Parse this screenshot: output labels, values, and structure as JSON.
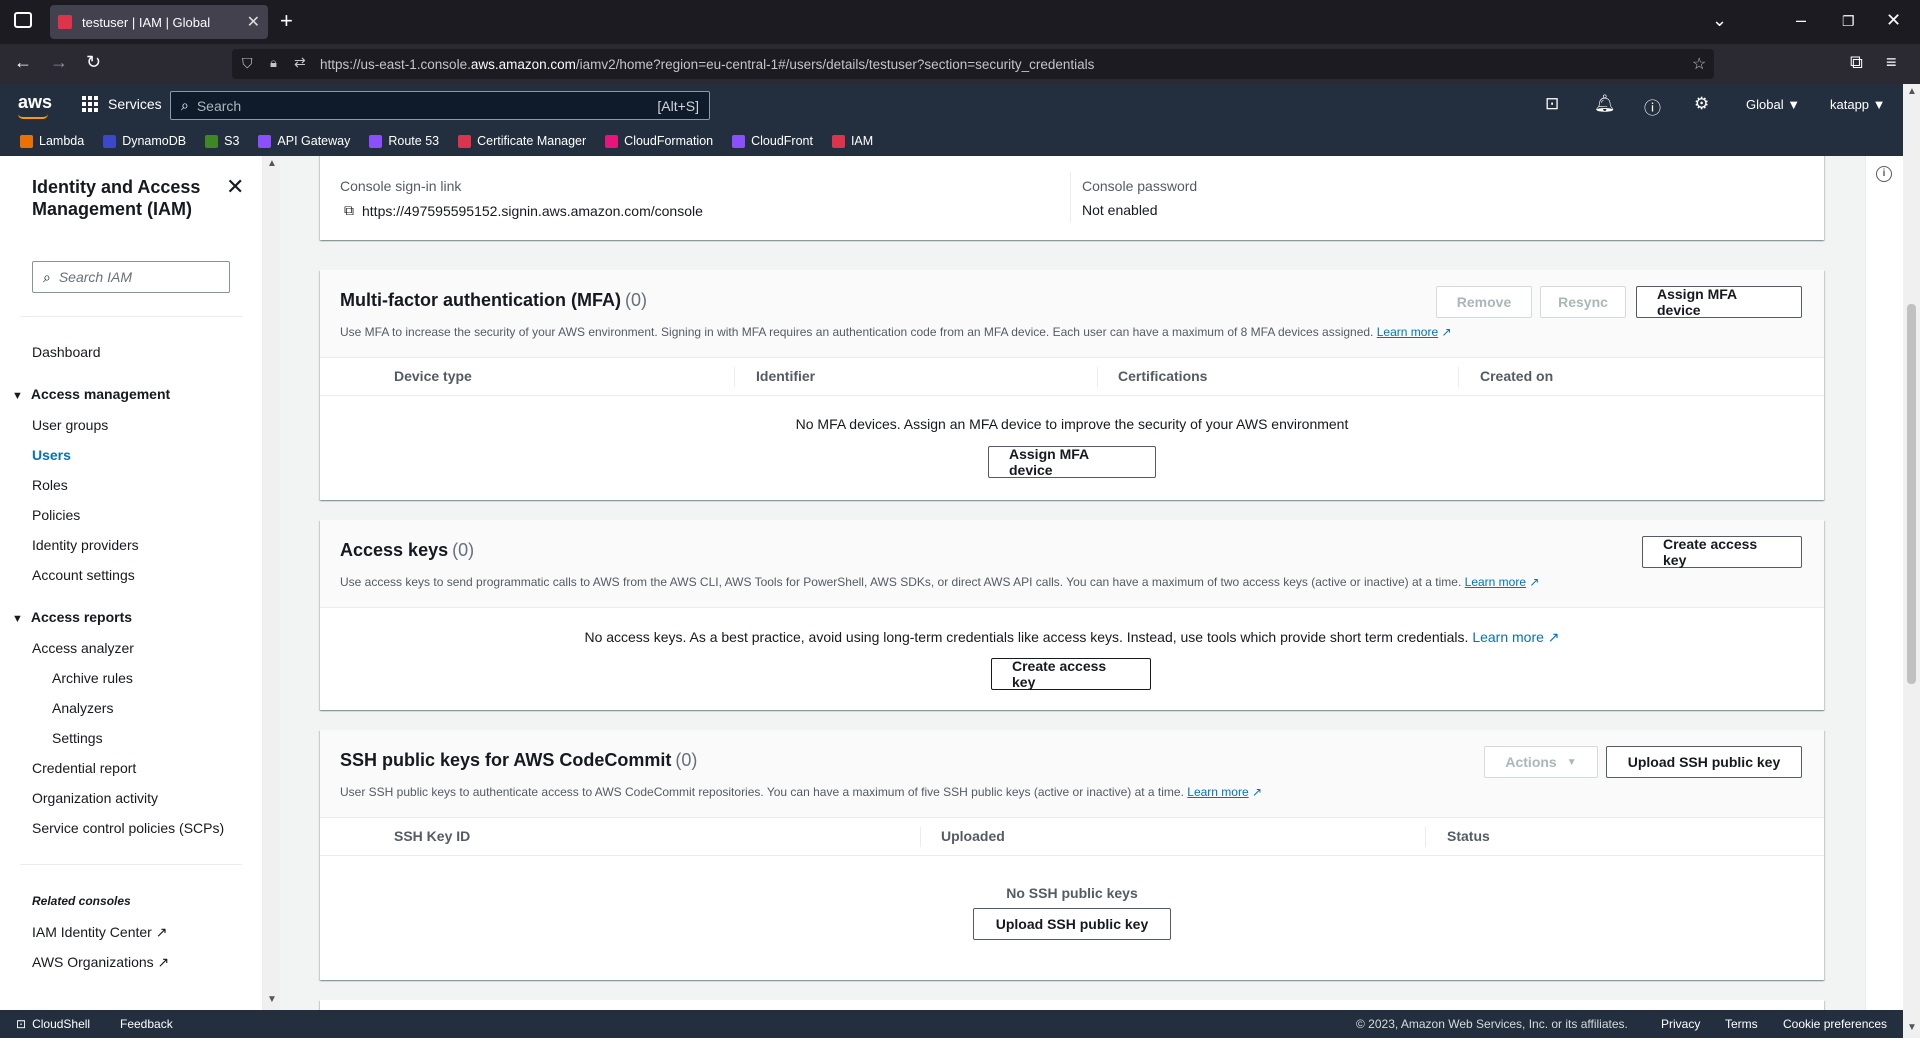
{
  "browser": {
    "tab_title": "testuser | IAM | Global",
    "url_prefix": "https://us-east-1.console.",
    "url_domain": "aws.amazon.com",
    "url_suffix": "/iamv2/home?region=eu-central-1#/users/details/testuser?section=security_credentials"
  },
  "aws_header": {
    "logo": "aws",
    "services": "Services",
    "search_placeholder": "Search",
    "search_shortcut": "[Alt+S]",
    "region": "Global ▼",
    "account": "katapp ▼"
  },
  "favorites": [
    {
      "label": "Lambda",
      "color": "#ed7100"
    },
    {
      "label": "DynamoDB",
      "color": "#3b48cc"
    },
    {
      "label": "S3",
      "color": "#3f8624"
    },
    {
      "label": "API Gateway",
      "color": "#8c4fff"
    },
    {
      "label": "Route 53",
      "color": "#8c4fff"
    },
    {
      "label": "Certificate Manager",
      "color": "#dd344c"
    },
    {
      "label": "CloudFormation",
      "color": "#e7157b"
    },
    {
      "label": "CloudFront",
      "color": "#8c4fff"
    },
    {
      "label": "IAM",
      "color": "#dd344c"
    }
  ],
  "sidebar": {
    "title": "Identity and Access Management (IAM)",
    "search_placeholder": "Search IAM",
    "dashboard": "Dashboard",
    "access_management": "Access management",
    "user_groups": "User groups",
    "users": "Users",
    "roles": "Roles",
    "policies": "Policies",
    "identity_providers": "Identity providers",
    "account_settings": "Account settings",
    "access_reports": "Access reports",
    "access_analyzer": "Access analyzer",
    "archive_rules": "Archive rules",
    "analyzers": "Analyzers",
    "settings": "Settings",
    "credential_report": "Credential report",
    "organization_activity": "Organization activity",
    "scps": "Service control policies (SCPs)",
    "related_consoles": "Related consoles",
    "iam_identity_center": "IAM Identity Center",
    "aws_organizations": "AWS Organizations"
  },
  "console": {
    "signin_label": "Console sign-in link",
    "signin_url": "https://497595595152.signin.aws.amazon.com/console",
    "password_label": "Console password",
    "password_value": "Not enabled"
  },
  "mfa": {
    "title": "Multi-factor authentication (MFA)",
    "count": "(0)",
    "remove": "Remove",
    "resync": "Resync",
    "assign": "Assign MFA device",
    "desc": "Use MFA to increase the security of your AWS environment. Signing in with MFA requires an authentication code from an MFA device. Each user can have a maximum of 8 MFA devices assigned.",
    "learn_more": "Learn more",
    "columns": [
      "Device type",
      "Identifier",
      "Certifications",
      "Created on"
    ],
    "empty": "No MFA devices. Assign an MFA device to improve the security of your AWS environment",
    "empty_button": "Assign MFA device"
  },
  "access_keys": {
    "title": "Access keys",
    "count": "(0)",
    "create": "Create access key",
    "desc": "Use access keys to send programmatic calls to AWS from the AWS CLI, AWS Tools for PowerShell, AWS SDKs, or direct AWS API calls. You can have a maximum of two access keys (active or inactive) at a time.",
    "learn_more": "Learn more",
    "empty": "No access keys. As a best practice, avoid using long-term credentials like access keys. Instead, use tools which provide short term credentials.",
    "empty_learn_more": "Learn more",
    "empty_button": "Create access key"
  },
  "ssh": {
    "title": "SSH public keys for AWS CodeCommit",
    "count": "(0)",
    "actions": "Actions",
    "upload": "Upload SSH public key",
    "desc": "User SSH public keys to authenticate access to AWS CodeCommit repositories. You can have a maximum of five SSH public keys (active or inactive) at a time.",
    "learn_more": "Learn more",
    "columns": [
      "SSH Key ID",
      "Uploaded",
      "Status"
    ],
    "empty": "No SSH public keys",
    "empty_button": "Upload SSH public key"
  },
  "footer": {
    "cloudshell": "CloudShell",
    "feedback": "Feedback",
    "copyright": "© 2023, Amazon Web Services, Inc. or its affiliates.",
    "privacy": "Privacy",
    "terms": "Terms",
    "cookie": "Cookie preferences"
  }
}
